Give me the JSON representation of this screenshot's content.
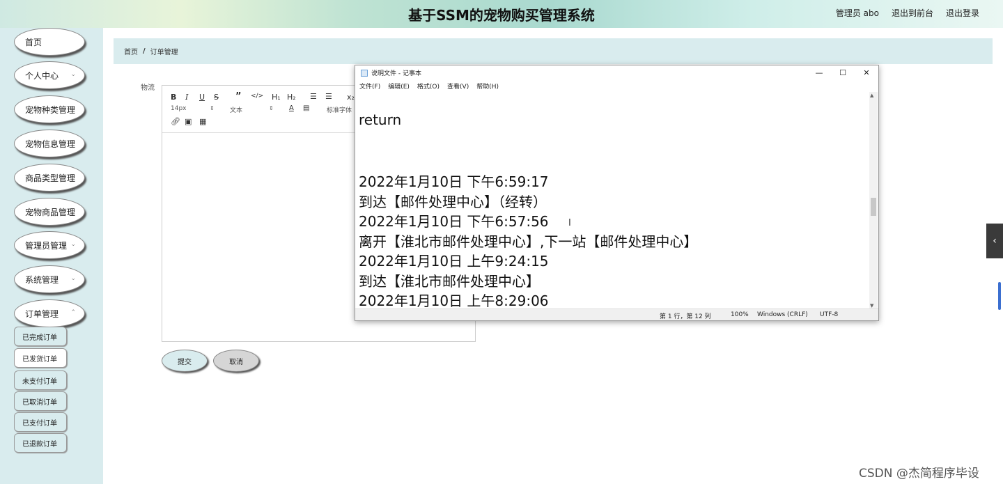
{
  "header": {
    "title": "基于SSM的宠物购买管理系统",
    "nav": [
      "管理员 abo",
      "退出到前台",
      "退出登录"
    ]
  },
  "sidebar": {
    "items": [
      {
        "label": "首页",
        "has_chevron": false
      },
      {
        "label": "个人中心",
        "has_chevron": true
      },
      {
        "label": "宠物种类管理",
        "has_chevron": false
      },
      {
        "label": "宠物信息管理",
        "has_chevron": false
      },
      {
        "label": "商品类型管理",
        "has_chevron": false
      },
      {
        "label": "宠物商品管理",
        "has_chevron": false
      },
      {
        "label": "管理员管理",
        "has_chevron": true
      },
      {
        "label": "系统管理",
        "has_chevron": true
      },
      {
        "label": "订单管理",
        "has_chevron": true
      }
    ],
    "sub_items": [
      {
        "label": "已完成订单",
        "active": false
      },
      {
        "label": "已发货订单",
        "active": true
      },
      {
        "label": "未支付订单",
        "active": false
      },
      {
        "label": "已取消订单",
        "active": false
      },
      {
        "label": "已支付订单",
        "active": false
      },
      {
        "label": "已退款订单",
        "active": false
      }
    ]
  },
  "breadcrumb": {
    "home": "首页",
    "separator": "/",
    "current": "订单管理"
  },
  "form": {
    "label": "物流",
    "font_size": "14px",
    "text_type": "文本",
    "font_family": "标准字体",
    "submit": "提交",
    "cancel": "取消"
  },
  "notepad": {
    "title": "说明文件 - 记事本",
    "menu": [
      "文件(F)",
      "编辑(E)",
      "格式(O)",
      "查看(V)",
      "帮助(H)"
    ],
    "lines": [
      "return",
      "2022年1月10日 下午6:59:17",
      "到达【邮件处理中心】（经转）",
      "2022年1月10日 下午6:57:56",
      "离开【淮北市邮件处理中心】,下一站【邮件处理中心】",
      "2022年1月10日 上午9:24:15",
      "到达【淮北市邮件处理中心】",
      "2022年1月10日 上午8:29:06"
    ],
    "status": {
      "position": "第 1 行，第 12 列",
      "zoom": "100%",
      "eol": "Windows (CRLF)",
      "encoding": "UTF-8"
    }
  },
  "watermark": "CSDN @杰简程序毕设",
  "colors": {
    "sidebar_bg": "#d9ecee",
    "accent": "#3b6fd0"
  }
}
